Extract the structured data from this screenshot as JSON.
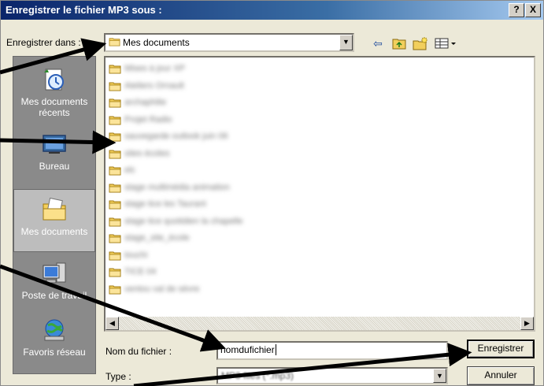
{
  "dialog": {
    "title": "Enregistrer le fichier MP3 sous :",
    "help_button": "?",
    "close_button": "X"
  },
  "save_in": {
    "label": "Enregistrer dans :",
    "value": "Mes documents"
  },
  "toolbar": {
    "back_icon": "back-arrow-icon",
    "up_icon": "up-folder-icon",
    "new_folder_icon": "new-folder-icon",
    "view_icon": "view-menu-icon"
  },
  "places": [
    {
      "label": "Mes documents récents",
      "icon": "recent-documents-icon"
    },
    {
      "label": "Bureau",
      "icon": "desktop-icon"
    },
    {
      "label": "Mes documents",
      "icon": "my-documents-icon"
    },
    {
      "label": "Poste de travail",
      "icon": "my-computer-icon"
    },
    {
      "label": "Favoris réseau",
      "icon": "network-places-icon"
    }
  ],
  "files": [
    "Mises à jour XP",
    "Ateliers Ornault",
    "archaphilie",
    "Projet Radio",
    "sauvegarde outlook juin 06",
    "sites écoles",
    "elc",
    "stage multimédia animation",
    "stage tice les Taurant",
    "stage tice quotidien la chapelle",
    "stage_site_école",
    "touchi",
    "TICE 04",
    "ventou val de sèvre"
  ],
  "filename": {
    "label": "Nom du fichier :",
    "value": "nomdufichier"
  },
  "filetype": {
    "label": "Type :",
    "value": "MP3 files (*.mp3)"
  },
  "buttons": {
    "save": "Enregistrer",
    "cancel": "Annuler"
  }
}
